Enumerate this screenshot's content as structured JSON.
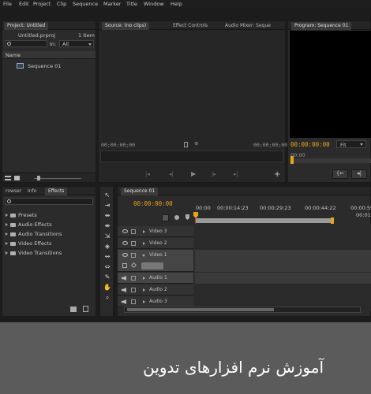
{
  "menu": [
    "File",
    "Edit",
    "Project",
    "Clip",
    "Sequence",
    "Marker",
    "Title",
    "Window",
    "Help"
  ],
  "project": {
    "tab": "Project: Untitled",
    "file": "Untitled.prproj",
    "count": "1 Item",
    "in_label": "In:",
    "in_value": "All",
    "column_name": "Name",
    "item": "Sequence 01"
  },
  "source": {
    "tabs": [
      "Source: (no clips)",
      "Effect Controls",
      "Audio Mixer: Seque"
    ],
    "tc_left": "00;00;00;00",
    "tc_right": "00;00;00;00"
  },
  "program": {
    "tab": "Program: Sequence 01",
    "tc": "00:00:00:00",
    "fit": "Fit",
    "ruler_tc": "00:00"
  },
  "effects": {
    "tabs": [
      "rowser",
      "Info",
      "Effects"
    ],
    "items": [
      "Presets",
      "Audio Effects",
      "Audio Transitions",
      "Video Effects",
      "Video Transitions"
    ]
  },
  "timeline": {
    "tab": "Sequence 01",
    "tc": "00:00:00:00",
    "ruler": [
      "00:00",
      "00:00:14:23",
      "00:00:29:23",
      "00:00:44:22",
      "00:00:59:22",
      "00:01"
    ],
    "video_tracks": [
      "Video 3",
      "Video 2",
      "Video 1"
    ],
    "audio_tracks": [
      "Audio 1",
      "Audio 2",
      "Audio 3"
    ]
  },
  "caption": "آموزش نرم افزارهای تدوین"
}
